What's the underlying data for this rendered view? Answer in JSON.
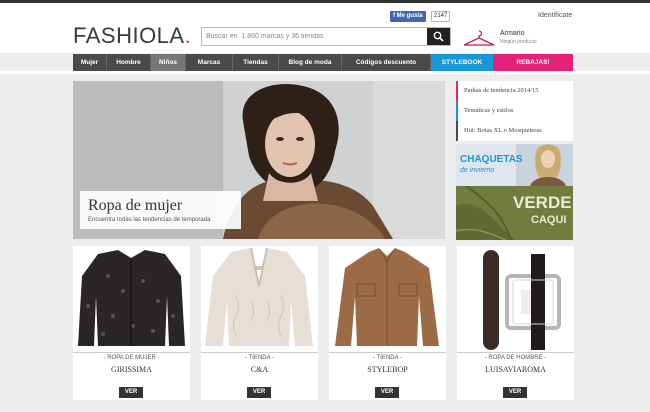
{
  "header": {
    "logo": "FASHIOLA",
    "logo_dot": ".",
    "search_placeholder": "Buscar en  1.860 marcas y 36 tiendas",
    "fb_like": "Me gusta",
    "fb_count": "2147",
    "identificate": "Identifícate",
    "armario": "Armario",
    "armario_sub": "Ningún producto"
  },
  "nav": {
    "items": [
      {
        "label": "Mujer"
      },
      {
        "label": "Hombre"
      },
      {
        "label": "Niños"
      },
      {
        "label": "Marcas"
      },
      {
        "label": "Tiendas"
      },
      {
        "label": "Blog de moda"
      },
      {
        "label": "Códigos descuento"
      },
      {
        "label": "STYLEBOOK"
      },
      {
        "label": "REBAJAS!"
      }
    ]
  },
  "hero": {
    "title": "Ropa de mujer",
    "subtitle": "Encuentra todas las tendencias de temporada"
  },
  "sidebar": {
    "links": [
      {
        "label": "Parkas de tendencia 2014/15"
      },
      {
        "label": "Temáticas y estilos"
      },
      {
        "label": "Hot: Botas XL o Mosqueteras"
      }
    ],
    "banner1_title": "CHAQUETAS",
    "banner1_sub": "de invierno",
    "banner2_title": "VERDE",
    "banner2_sub": "CAQUI"
  },
  "cards": [
    {
      "category": "- ROPA DE MUJER -",
      "name": "GIRISSIMA",
      "button": "VER"
    },
    {
      "category": "- TIENDA -",
      "name": "C&A",
      "button": "VER"
    },
    {
      "category": "- TIENDA -",
      "name": "STYLEBOP",
      "button": "VER"
    },
    {
      "category": "- ROPA DE HOMBRE -",
      "name": "LUISAVIAROMA",
      "button": "VER"
    }
  ],
  "colors": {
    "brand_pink": "#e5227a",
    "stylebook_blue": "#1796d8",
    "nav_bg": "#4a4a4a"
  }
}
